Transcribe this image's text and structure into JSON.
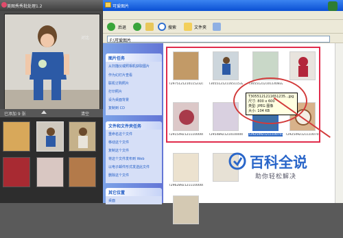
{
  "app": {
    "title": "美图秀秀批处理1.2",
    "compare_label": "对比",
    "photo_count": "已添加 9 张",
    "clear_label": "清空"
  },
  "explorer": {
    "title": "可爱图片",
    "toolbar": {
      "back_label": "后退",
      "search_label": "搜索",
      "folders_label": "文件夹"
    },
    "address": "F:\\可爱图片",
    "tasks_header": "图片任务",
    "tasks": [
      "从扫描仪或照相机获取图片",
      "作为幻灯片查看",
      "联机订购照片",
      "打印照片",
      "设为桌面背景",
      "复制到 CD"
    ],
    "file_tasks_header": "文件和文件夹任务",
    "file_tasks": [
      "重命名这个文件",
      "移动这个文件",
      "复制这个文件",
      "将这个文件发布到 Web",
      "以电子邮件形式发送此文件",
      "删除这个文件"
    ],
    "other_header": "其它位置",
    "other_item": "桌面"
  },
  "files": {
    "row1": [
      "T29751212101152321...",
      "T30551212116511532...",
      "T30551212101140832..."
    ],
    "row2": [
      "T29154921211100000...",
      "T29548921210100000...",
      "T29254921211100707...",
      "T29254921211100707..."
    ],
    "row3": [
      "T29628921211100000..."
    ],
    "selected_label": "T29254921211100707....jpg"
  },
  "tooltip": {
    "name": "T3055121211651235...jpg",
    "size": "尺寸: 800 x 600",
    "type": "类型: JPEG 图像",
    "filesize": "大小: 104 KB"
  },
  "watermark": {
    "brand": "百科全说",
    "slogan": "助你轻松解决"
  },
  "colors": {
    "xp_blue": "#0a4fd3",
    "task_pane": "#6375d6",
    "annotation_red": "#d23a3a",
    "watermark_blue": "#2a66c9"
  }
}
